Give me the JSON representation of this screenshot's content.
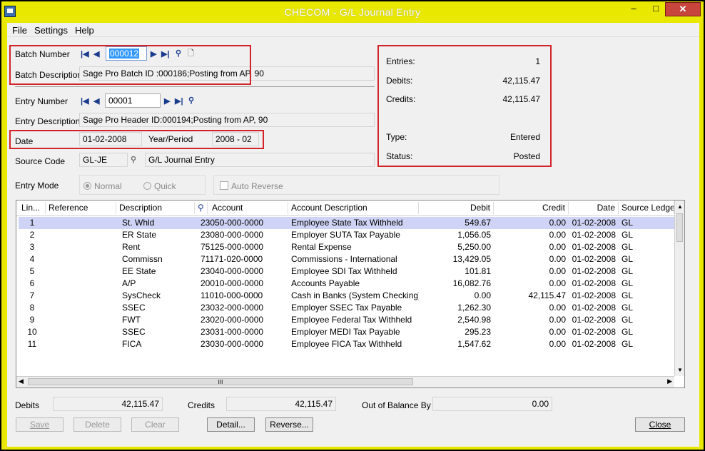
{
  "window": {
    "title": "CHECOM - G/L Journal Entry",
    "min": "–",
    "max": "□",
    "close": "✕"
  },
  "menu": [
    "File",
    "Settings",
    "Help"
  ],
  "batch": {
    "number_label": "Batch Number",
    "number_value": "000012",
    "description_label": "Batch Description",
    "description_value": "Sage Pro Batch ID :000186;Posting from AP, 90"
  },
  "entry": {
    "number_label": "Entry Number",
    "number_value": "00001",
    "description_label": "Entry Description",
    "description_value": "Sage Pro Header ID:000194;Posting from AP, 90",
    "date_label": "Date",
    "date_value": "01-02-2008",
    "period_label": "Year/Period",
    "period_value": "2008 - 02",
    "source_label": "Source Code",
    "source_code": "GL-JE",
    "source_desc": "G/L Journal Entry",
    "mode_label": "Entry Mode",
    "mode_normal": "Normal",
    "mode_quick": "Quick",
    "auto_reverse": "Auto Reverse"
  },
  "summary": {
    "entries_label": "Entries:",
    "entries_value": "1",
    "debits_label": "Debits:",
    "debits_value": "42,115.47",
    "credits_label": "Credits:",
    "credits_value": "42,115.47",
    "type_label": "Type:",
    "type_value": "Entered",
    "status_label": "Status:",
    "status_value": "Posted"
  },
  "grid": {
    "columns": [
      "Lin...",
      "Reference",
      "Description",
      "Account",
      "Account Description",
      "Debit",
      "Credit",
      "Date",
      "Source Ledger"
    ],
    "rows": [
      [
        "1",
        "",
        "St. Whld",
        "23050-000-0000",
        "Employee State Tax Withheld",
        "549.67",
        "0.00",
        "01-02-2008",
        "GL"
      ],
      [
        "2",
        "",
        "ER State",
        "23080-000-0000",
        "Employer SUTA Tax Payable",
        "1,056.05",
        "0.00",
        "01-02-2008",
        "GL"
      ],
      [
        "3",
        "",
        "Rent",
        "75125-000-0000",
        "Rental Expense",
        "5,250.00",
        "0.00",
        "01-02-2008",
        "GL"
      ],
      [
        "4",
        "",
        "Commissn",
        "71171-020-0000",
        "Commissions - International",
        "13,429.05",
        "0.00",
        "01-02-2008",
        "GL"
      ],
      [
        "5",
        "",
        "EE State",
        "23040-000-0000",
        "Employee SDI Tax Withheld",
        "101.81",
        "0.00",
        "01-02-2008",
        "GL"
      ],
      [
        "6",
        "",
        "A/P",
        "20010-000-0000",
        "Accounts Payable",
        "16,082.76",
        "0.00",
        "01-02-2008",
        "GL"
      ],
      [
        "7",
        "",
        "SysCheck",
        "11010-000-0000",
        "Cash in Banks (System Checking)",
        "0.00",
        "42,115.47",
        "01-02-2008",
        "GL"
      ],
      [
        "8",
        "",
        "SSEC",
        "23032-000-0000",
        "Employer SSEC Tax Payable",
        "1,262.30",
        "0.00",
        "01-02-2008",
        "GL"
      ],
      [
        "9",
        "",
        "FWT",
        "23020-000-0000",
        "Employee Federal Tax Withheld",
        "2,540.98",
        "0.00",
        "01-02-2008",
        "GL"
      ],
      [
        "10",
        "",
        "SSEC",
        "23031-000-0000",
        "Employer MEDI Tax Payable",
        "295.23",
        "0.00",
        "01-02-2008",
        "GL"
      ],
      [
        "11",
        "",
        "FICA",
        "23030-000-0000",
        "Employee FICA Tax Withheld",
        "1,547.62",
        "0.00",
        "01-02-2008",
        "GL"
      ]
    ],
    "hscroll_grip": "III"
  },
  "totals": {
    "debits_label": "Debits",
    "debits_value": "42,115.47",
    "credits_label": "Credits",
    "credits_value": "42,115.47",
    "oob_label": "Out of Balance By",
    "oob_value": "0.00"
  },
  "buttons": {
    "save": "Save",
    "delete": "Delete",
    "clear": "Clear",
    "detail": "Detail...",
    "reverse": "Reverse...",
    "close": "Close"
  },
  "colors": {
    "title_bg": "#e8e800",
    "highlight": "#d2232a",
    "selected_row": "#cfd3f5"
  }
}
